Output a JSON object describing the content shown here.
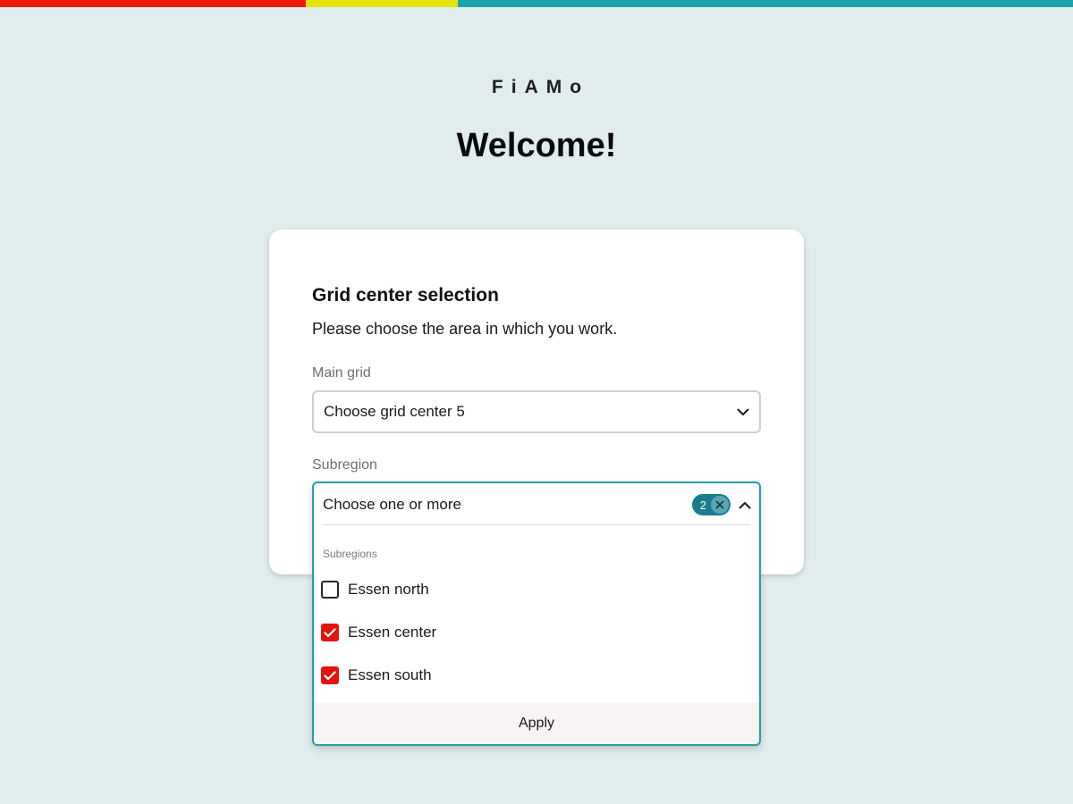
{
  "colors": {
    "bar_red": "#ee1c0e",
    "bar_yellow": "#e5e50a",
    "bar_teal": "#1fa4ad",
    "accent": "#1a7d8e",
    "checkbox_checked": "#e3140e",
    "focus_border": "#23a0a8"
  },
  "header": {
    "logo": "FiAMo",
    "welcome": "Welcome!"
  },
  "card": {
    "title": "Grid center selection",
    "description": "Please choose the area in which you work.",
    "main_grid": {
      "label": "Main grid",
      "value": "Choose grid center 5",
      "icon": "chevron-down-icon"
    },
    "subregion": {
      "label": "Subregion",
      "placeholder": "Choose one or more",
      "selected_count": "2",
      "icon": "chevron-up-icon",
      "group_label": "Subregions",
      "options": [
        {
          "label": "Essen north",
          "checked": false
        },
        {
          "label": "Essen center",
          "checked": true
        },
        {
          "label": "Essen south",
          "checked": true
        }
      ],
      "apply_label": "Apply"
    }
  }
}
